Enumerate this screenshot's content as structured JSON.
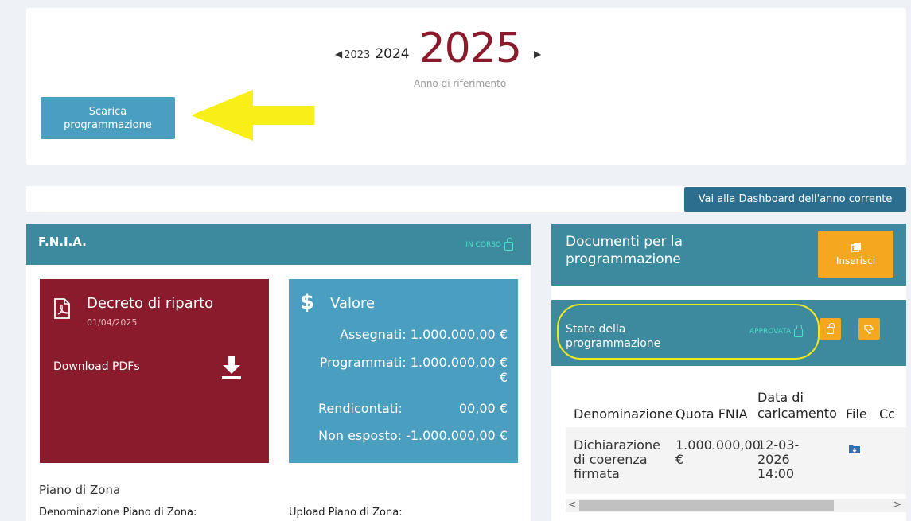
{
  "year_nav": {
    "prev_arrow": "◀",
    "prev2": "2023",
    "prev1": "2024",
    "current": "2025",
    "next_arrow": "▶",
    "subtitle": "Anno di riferimento"
  },
  "download_button": {
    "line1": "Scarica",
    "line2": "programmazione"
  },
  "dashboard_button": "Vai alla Dashboard dell'anno corrente",
  "fnia": {
    "title": "F.N.I.A.",
    "status": "IN CORSO",
    "decreto": {
      "title": "Decreto di riparto",
      "date": "01/04/2025",
      "download_label": "Download PDFs"
    },
    "valore": {
      "title": "Valore",
      "assegnati": "Assegnati: 1.000.000,00 €",
      "programmati": "Programmati: 1.000.000,00 €",
      "programmati_extra": "€",
      "rendicontati_label": "Rendicontati:",
      "rendicontati_value": "00,00 €",
      "non_esposto": "Non esposto: -1.000.000,00 €"
    },
    "piano_zona": {
      "title": "Piano di Zona",
      "denominazione_label": "Denominazione Piano di Zona:",
      "upload_label": "Upload Piano di Zona:"
    }
  },
  "documents": {
    "title": "Documenti per la programmazione",
    "insert_label": "Inserisci",
    "stato": {
      "title": "Stato della programmazione",
      "status": "APPROVATA"
    },
    "table": {
      "headers": [
        "Denominazione",
        "Quota FNIA",
        "Data di caricamento",
        "File",
        "Cc"
      ],
      "rows": [
        {
          "denominazione": "Dichiarazione di coerenza firmata",
          "quota": "1.000.000,00 €",
          "data": "12-03-2026 14:00"
        }
      ]
    },
    "scroll_left": "<",
    "scroll_right": ">"
  },
  "colors": {
    "teal_header": "#3d8a9e",
    "dark_teal": "#2b6e8e",
    "blue_card": "#4a9ec0",
    "maroon_card": "#8a1b2c",
    "orange_button": "#f3a820",
    "status_green": "#4ce0c7",
    "annotation_yellow": "#f0ea1c"
  }
}
